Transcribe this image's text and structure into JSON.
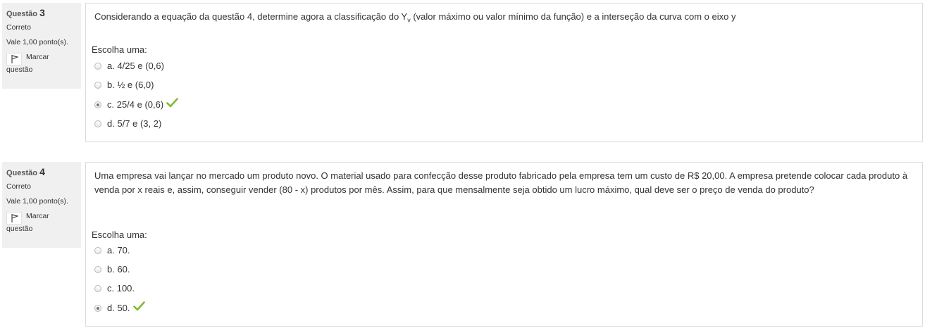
{
  "questions": [
    {
      "label": "Questão",
      "number": "3",
      "state": "Correto",
      "grade": "Vale 1,00 ponto(s).",
      "flag_label": "Marcar",
      "flag_label2": "questão",
      "text_before": "Considerando a equação da questão 4, determine agora a classificação do Y",
      "text_sub": "v",
      "text_after": " (valor máximo ou valor mínimo da função) e a interseção da curva com o eixo y",
      "prompt": "Escolha uma:",
      "answers": [
        {
          "label": "a. 4/25 e (0,6)",
          "selected": false,
          "correct": false
        },
        {
          "label": "b. ½ e (6,0)",
          "selected": false,
          "correct": false
        },
        {
          "label": "c. 25/4 e (0,6)",
          "selected": true,
          "correct": true
        },
        {
          "label": "d. 5/7 e (3, 2)",
          "selected": false,
          "correct": false
        }
      ]
    },
    {
      "label": "Questão",
      "number": "4",
      "state": "Correto",
      "grade": "Vale 1,00 ponto(s).",
      "flag_label": "Marcar",
      "flag_label2": "questão",
      "text": "Uma empresa vai lançar no mercado um produto novo. O material usado para confecção desse produto fabricado pela empresa tem um custo de R$ 20,00. A empresa pretende colocar cada produto à venda por x reais e, assim, conseguir vender (80 - x) produtos por mês. Assim, para que mensalmente seja obtido um lucro máximo, qual deve ser o preço de venda do produto?",
      "prompt": "Escolha uma:",
      "answers": [
        {
          "label": "a. 70.",
          "selected": false,
          "correct": false
        },
        {
          "label": "b. 60.",
          "selected": false,
          "correct": false
        },
        {
          "label": "c. 100.",
          "selected": false,
          "correct": false
        },
        {
          "label": "d. 50.",
          "selected": true,
          "correct": true
        }
      ]
    }
  ],
  "colors": {
    "check": "#7dbb2e",
    "info_bg": "#f0f0f0",
    "border": "#dcdcdc"
  }
}
